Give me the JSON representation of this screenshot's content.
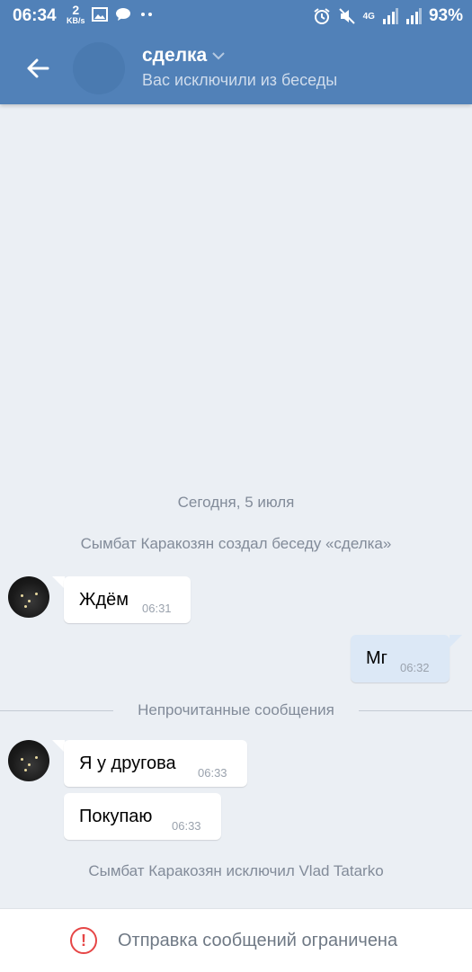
{
  "status_bar": {
    "time": "06:34",
    "net_speed_value": "2",
    "net_speed_unit": "KB/s",
    "network_type": "4G",
    "battery": "93%"
  },
  "header": {
    "title": "сделка",
    "subtitle": "Вас исключили из беседы"
  },
  "feed": {
    "date_separator": "Сегодня, 5 июля",
    "service_created": "Сымбат Каракозян создал беседу «сделка»",
    "unread_separator": "Непрочитанные сообщения",
    "service_kicked": "Сымбат Каракозян исключил Vlad Tatarko",
    "messages": [
      {
        "text": "Ждём",
        "time": "06:31",
        "direction": "in"
      },
      {
        "text": "Мг",
        "time": "06:32",
        "direction": "out"
      },
      {
        "text": "Я у другова",
        "time": "06:33",
        "direction": "in"
      },
      {
        "text": "Покупаю",
        "time": "06:33",
        "direction": "in"
      }
    ]
  },
  "bottom": {
    "restriction_text": "Отправка сообщений ограничена",
    "icon": "exclamation-circle-icon"
  },
  "colors": {
    "header_bg": "#5181b8",
    "feed_bg": "#ebeff4",
    "outgoing_bubble": "#dce8f6",
    "warning": "#e64646"
  }
}
